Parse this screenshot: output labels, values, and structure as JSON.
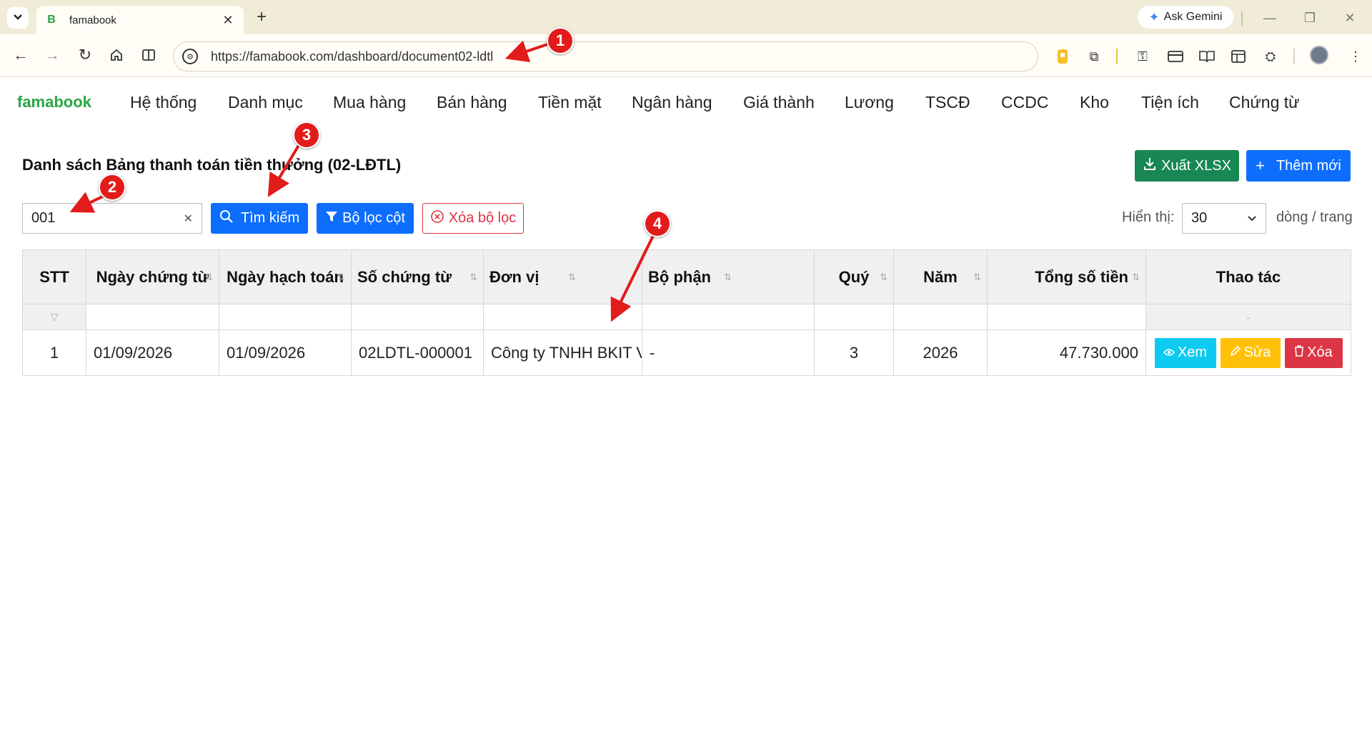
{
  "browser": {
    "tab_title": "famabook",
    "tab_favicon": "B",
    "url": "https://famabook.com/dashboard/document02-ldtl",
    "gemini_label": "Ask Gemini"
  },
  "nav": {
    "brand": "famabook",
    "menu": [
      "Hệ thống",
      "Danh mục",
      "Mua hàng",
      "Bán hàng",
      "Tiền mặt",
      "Ngân hàng",
      "Giá thành",
      "Lương",
      "TSCĐ",
      "CCDC",
      "Kho",
      "Tiện ích",
      "Chứng từ"
    ]
  },
  "page": {
    "title": "Danh sách Bảng thanh toán tiền thưởng (02-LĐTL)",
    "export_label": "Xuất XLSX",
    "add_label": "Thêm mới",
    "search_value": "001",
    "search_button": "Tìm kiếm",
    "column_filter_button": "Bộ lọc cột",
    "clear_filter_button": "Xóa bộ lọc",
    "show_label": "Hiển thị:",
    "page_size": "30",
    "per_page_label": "dòng / trang"
  },
  "table": {
    "headers": {
      "stt": "STT",
      "doc_date": "Ngày chứng từ",
      "post_date": "Ngày hạch toán",
      "doc_no": "Số chứng từ",
      "unit": "Đơn vị",
      "dept": "Bộ phận",
      "quarter": "Quý",
      "year": "Năm",
      "total": "Tổng số tiền",
      "actions": "Thao tác"
    },
    "filter_actions_placeholder": "-",
    "rows": [
      {
        "stt": "1",
        "doc_date": "01/09/2026",
        "post_date": "01/09/2026",
        "doc_no": "02LDTL-000001",
        "unit": "Công ty TNHH BKIT V",
        "dept": "-",
        "quarter": "3",
        "year": "2026",
        "total": "47.730.000"
      }
    ],
    "row_actions": {
      "view": "Xem",
      "edit": "Sửa",
      "delete": "Xóa"
    }
  },
  "annotations": [
    "1",
    "2",
    "3",
    "4"
  ],
  "colors": {
    "primary": "#0d6efd",
    "success": "#198754",
    "info": "#0dcaf0",
    "warning": "#ffc107",
    "danger": "#dc3545",
    "brand": "#28a745",
    "annotation": "#e21b1b"
  }
}
